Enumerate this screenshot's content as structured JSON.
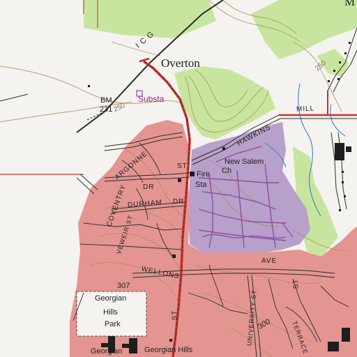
{
  "map": {
    "place_labels": {
      "overton": "Overton",
      "new_salem_1": "New Salem",
      "new_salem_2": "Ch",
      "fire_sta_1": "Fire",
      "fire_sta_2": "Sta",
      "substa": "Substa",
      "bm_1": "BM",
      "bm_2": "231",
      "georgian_hills_park_1": "Georgian",
      "georgian_hills_park_2": "Hills",
      "georgian_hills_park_3": "Park",
      "georgian": "Georgian",
      "georgian_hills": "Georgian Hills",
      "top_right_cut": "M"
    },
    "road_labels": {
      "icg": "I C G",
      "hawkins": "HAWKINS",
      "mill": "MILL",
      "argonne": "ARGONNE",
      "st_top": "ST",
      "coventry": "COVENTRY",
      "dr_1": "DR",
      "durham": "DURHAM",
      "dr_2": "DR",
      "vineir_st": "VEWEIR ST",
      "wellons": "WELLONS",
      "ave": "AVE",
      "university_st": "UNIVERSITY ST.",
      "st_right": "ST",
      "st_main": "ST",
      "terrace": "TERRACE",
      "n_307": "307",
      "n_300": "300"
    },
    "contour_labels": {
      "c250_left": "250",
      "c250_top": "250"
    },
    "colors": {
      "background": "#f4f3ef",
      "urban_tint": "#e49591",
      "woodland": "#c8e59f",
      "purple_tint": "#b7a0c9",
      "contour": "#b08a5e",
      "water": "#4a86c9",
      "road_red": "#c8302f",
      "road_black": "#2c2c2c",
      "grid_red": "#d2554f"
    }
  }
}
